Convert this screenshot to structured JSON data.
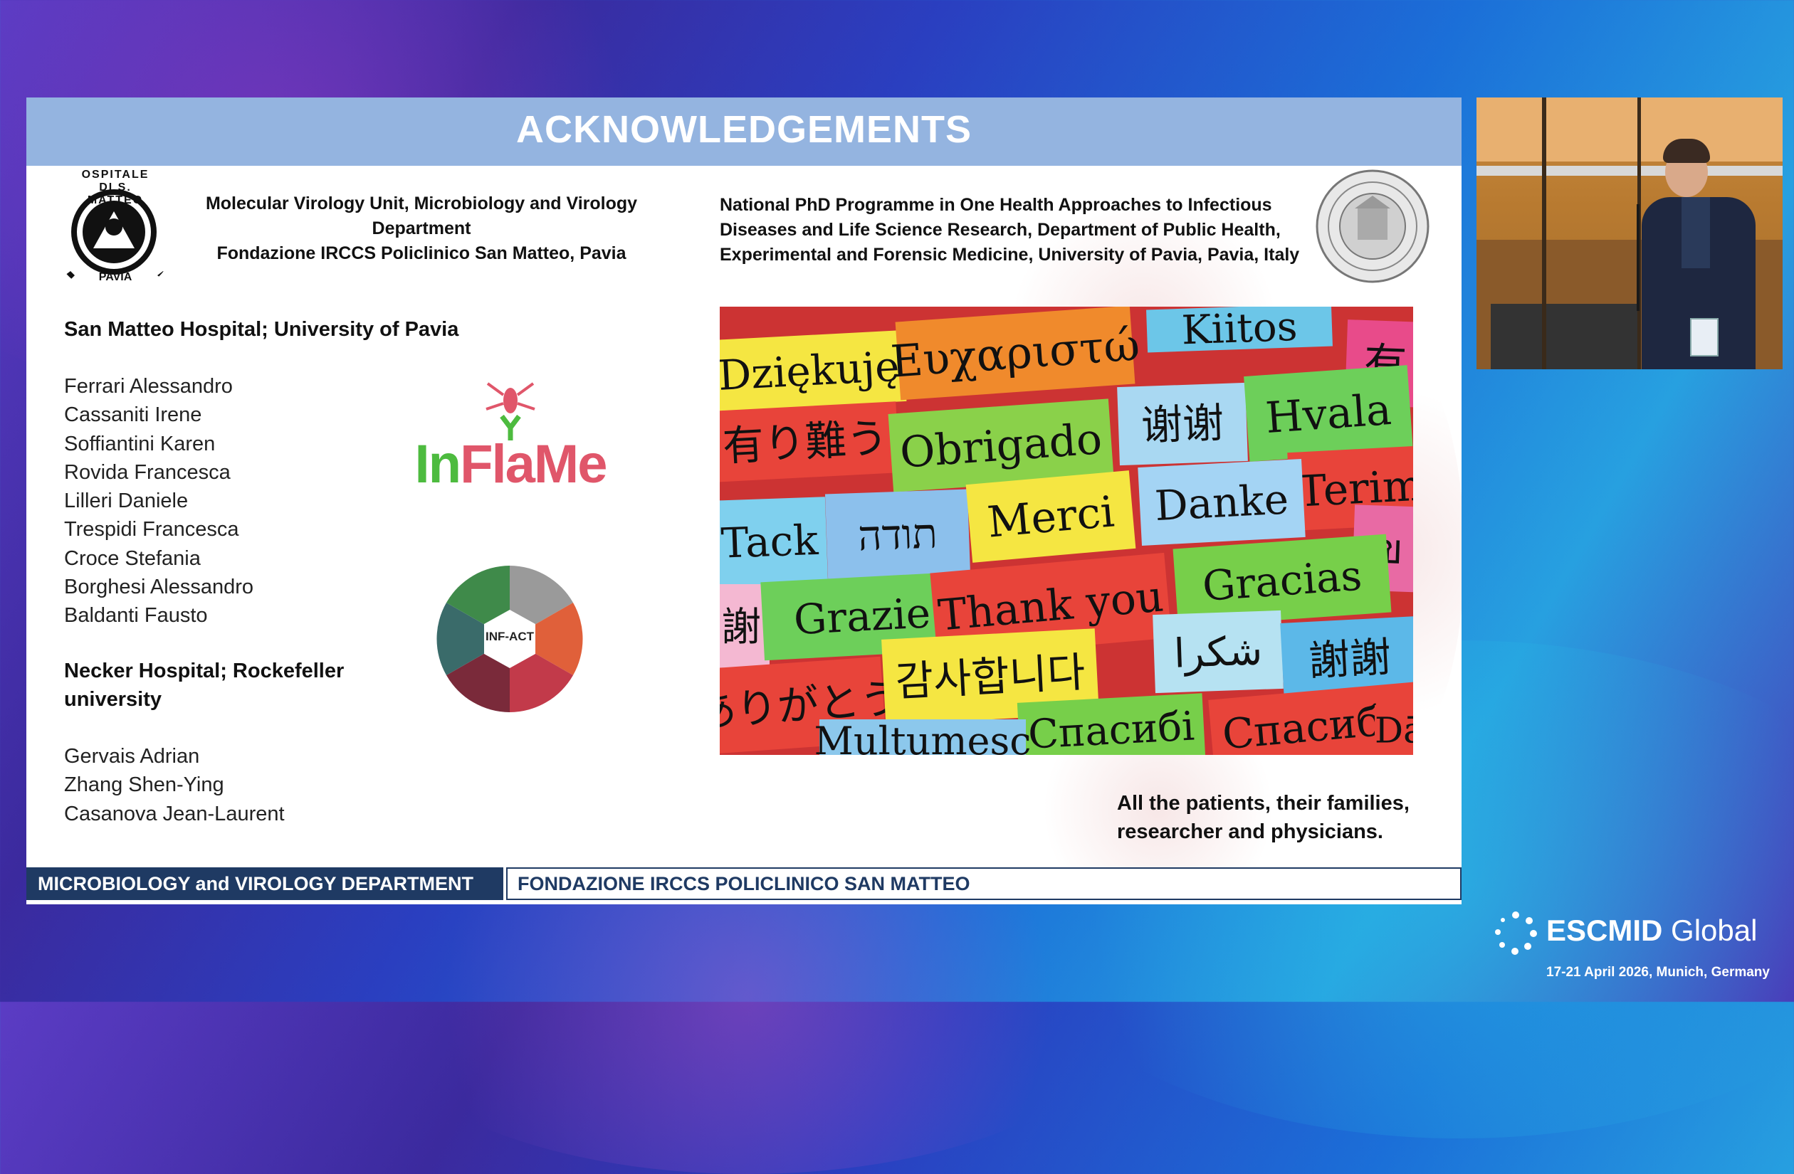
{
  "slide": {
    "title": "ACKNOWLEDGEMENTS",
    "left_affiliation": [
      "Molecular Virology Unit, Microbiology and Virology",
      "Department",
      "Fondazione IRCCS Policlinico San Matteo, Pavia"
    ],
    "right_affiliation": [
      "National PhD Programme in One Health Approaches to Infectious",
      "Diseases and Life Science Research, Department of Public Health,",
      "Experimental and Forensic Medicine, University of Pavia, Pavia, Italy"
    ],
    "seal_left_text": "OSPITALE DI S. MATTEO",
    "seal_left_city": "PAVIA",
    "group1_heading": "San Matteo Hospital; University of Pavia",
    "group1_names": [
      "Ferrari Alessandro",
      "Cassaniti Irene",
      "Soffiantini Karen",
      "Rovida Francesca",
      "Lilleri Daniele",
      "Trespidi Francesca",
      "Croce Stefania",
      "Borghesi Alessandro",
      "Baldanti Fausto"
    ],
    "group2_heading": [
      "Necker Hospital; Rockefeller",
      "university"
    ],
    "group2_names": [
      "Gervais Adrian",
      "Zhang Shen-Ying",
      "Casanova Jean-Laurent"
    ],
    "logo_inflame": {
      "part1": "In",
      "part2": "Fla",
      "part3": "Me"
    },
    "logo_infact": "INF-ACT",
    "patients_note": [
      "All the patients, their families,",
      "researcher and physicians."
    ],
    "footer_left": "MICROBIOLOGY and VIROLOGY DEPARTMENT",
    "footer_right": "FONDAZIONE IRCCS POLICLINICO SAN MATTEO",
    "thank_you_words": [
      {
        "text": "Dziękuję",
        "color": "#f5e642"
      },
      {
        "text": "Ευχαριστώ",
        "color": "#f08a2c"
      },
      {
        "text": "Kiitos",
        "color": "#6cc6e8"
      },
      {
        "text": "有",
        "color": "#e84b8a"
      },
      {
        "text": "有り難う",
        "color": "#e8443a"
      },
      {
        "text": "Obrigado",
        "color": "#8ad14a"
      },
      {
        "text": "谢谢",
        "color": "#a9d8f2"
      },
      {
        "text": "Hvala",
        "color": "#6dcf5a"
      },
      {
        "text": "Terim",
        "color": "#e8443a"
      },
      {
        "text": "Tack",
        "color": "#7fd0ee"
      },
      {
        "text": "תודה",
        "color": "#8cc0ec"
      },
      {
        "text": "Merci",
        "color": "#f5e642"
      },
      {
        "text": "Danke",
        "color": "#a4d4f4"
      },
      {
        "text": "ข",
        "color": "#e86aa4"
      },
      {
        "text": "謝",
        "color": "#f4b8d2"
      },
      {
        "text": "Grazie",
        "color": "#6dcf5a"
      },
      {
        "text": "Thank you",
        "color": "#e8443a"
      },
      {
        "text": "Gracias",
        "color": "#77cf4a"
      },
      {
        "text": "ありがとう",
        "color": "#e8443a"
      },
      {
        "text": "감사합니다",
        "color": "#f5e642"
      },
      {
        "text": "شكرا",
        "color": "#b6e2f2"
      },
      {
        "text": "謝謝",
        "color": "#5cb8e8"
      },
      {
        "text": "Спасибі",
        "color": "#77cf4a"
      },
      {
        "text": "Спасибо",
        "color": "#e8443a"
      },
      {
        "text": "Multumesc",
        "color": "#8cc8ec"
      },
      {
        "text": "Dā",
        "color": "#e8443a"
      }
    ]
  },
  "overlay": {
    "brand_light": "ESCMID",
    "brand_bold": "Global",
    "brand_date": "17-21 April 2026, Munich, Germany"
  }
}
